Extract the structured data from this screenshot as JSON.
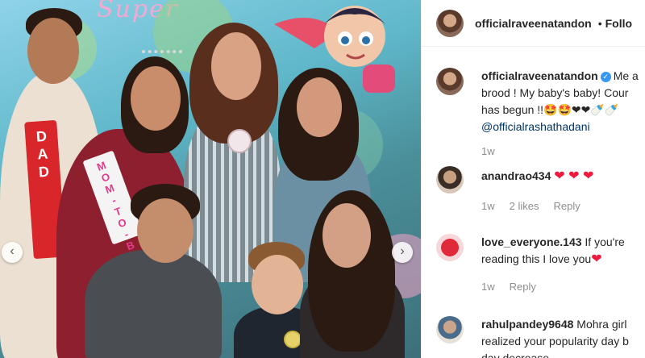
{
  "photo": {
    "banner_text": "Super",
    "sash_label": "DAD",
    "sash_sub": "TO BE",
    "mom_sash": "MOM-TO-BE"
  },
  "header": {
    "username": "officialraveenatandon",
    "separator": "•",
    "follow_label": "Follo"
  },
  "comments": [
    {
      "username": "officialraveenatandon",
      "verified": true,
      "lines": [
        "Me a",
        "brood ! My baby's baby! Cour",
        "has begun !!🤩🤩❤❤🍼🍼"
      ],
      "mention": "@officialrashathadani",
      "time": "1w"
    },
    {
      "username": "anandrao434",
      "text": "❤ ❤ ❤",
      "time": "1w",
      "likes": "2 likes",
      "reply": "Reply"
    },
    {
      "username": "love_everyone.143",
      "text_part": "If you're",
      "line2": "reading this I love you",
      "emoji": "❤",
      "time": "1w",
      "reply": "Reply"
    },
    {
      "username": "rahulpandey9648",
      "text_part": "Mohra girl",
      "line2": "realized your popularity day b",
      "line3": "day decrease"
    }
  ],
  "colors": {
    "accent": "#3897f0",
    "heart": "#ed1c3e",
    "meta": "#8e8e8e"
  }
}
